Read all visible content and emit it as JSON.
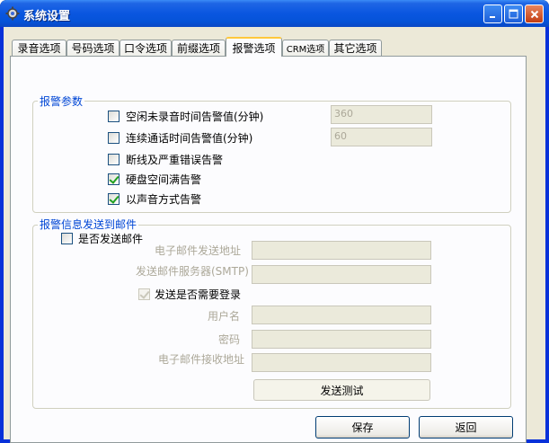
{
  "window": {
    "title": "系统设置",
    "minimize_icon": "minimize-icon",
    "maximize_icon": "maximize-icon",
    "close_icon": "close-icon"
  },
  "tabs": [
    {
      "label": "录音选项",
      "active": false
    },
    {
      "label": "号码选项",
      "active": false
    },
    {
      "label": "口令选项",
      "active": false
    },
    {
      "label": "前缀选项",
      "active": false
    },
    {
      "label": "报警选项",
      "active": true
    },
    {
      "label": "CRM选项",
      "active": false
    },
    {
      "label": "其它选项",
      "active": false
    }
  ],
  "alarm_params": {
    "title": "报警参数",
    "idle_alarm": {
      "label": "空闲未录音时间告警值(分钟)",
      "checked": false,
      "value": "360"
    },
    "call_alarm": {
      "label": "连续通话时间告警值(分钟)",
      "checked": false,
      "value": "60"
    },
    "disconnect_alarm": {
      "label": "断线及严重错误告警",
      "checked": false
    },
    "disk_full_alarm": {
      "label": "硬盘空间满告警",
      "checked": true
    },
    "sound_alarm": {
      "label": "以声音方式告警",
      "checked": true
    }
  },
  "email": {
    "title": "报警信息发送到邮件",
    "send_email": {
      "label": "是否发送邮件",
      "checked": false
    },
    "sender_address_label": "电子邮件发送地址",
    "smtp_label": "发送邮件服务器(SMTP)",
    "need_login": {
      "label": "发送是否需要登录",
      "checked": true
    },
    "username_label": "用户名",
    "password_label": "密码",
    "recipient_label": "电子邮件接收地址",
    "test_button": "发送测试"
  },
  "footer": {
    "save_button": "保存",
    "back_button": "返回"
  }
}
